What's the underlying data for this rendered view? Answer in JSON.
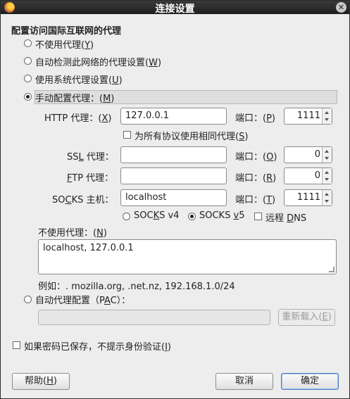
{
  "window": {
    "title": "连接设置"
  },
  "section_title": "配置访问国际互联网的代理",
  "options": {
    "no_proxy": {
      "label": "不使用代理(",
      "key": "Y",
      "tail": ")"
    },
    "auto_detect": {
      "label": "自动检测此网络的代理设置(",
      "key": "W",
      "tail": ")"
    },
    "system_proxy": {
      "label": "使用系统代理设置(",
      "key": "U",
      "tail": ")"
    },
    "manual": {
      "label": "手动配置代理：(",
      "key": "M",
      "tail": ")"
    }
  },
  "http": {
    "label_pre": "HTTP 代理：(",
    "key": "X",
    "label_post": ")",
    "value": "127.0.0.1",
    "port_label_pre": "端口：(",
    "port_key": "P",
    "port_label_post": ")",
    "port": "1111"
  },
  "same_proxy": {
    "label": "为所有协议使用相同代理(",
    "key": "S",
    "tail": ")"
  },
  "ssl": {
    "label_pre": "SS",
    "key": "L",
    "label_post": " 代理：",
    "value": "",
    "port_label_pre": "端口：(",
    "port_key": "O",
    "port_label_post": ")",
    "port": "0"
  },
  "ftp": {
    "label_pre": "",
    "key": "F",
    "label_post": "TP 代理：",
    "value": "",
    "port_label_pre": "端口：(",
    "port_key": "R",
    "port_label_post": ")",
    "port": "0"
  },
  "socks": {
    "label_pre": "SO",
    "key": "C",
    "label_post": "KS 主机：",
    "value": "localhost",
    "port_label_pre": "端口：(",
    "port_key": "T",
    "port_label_post": ")",
    "port": "1111"
  },
  "socks_v4": {
    "label_pre": "SOC",
    "key": "K",
    "label_post": "S v4"
  },
  "socks_v5": {
    "label_pre": "SOCKS ",
    "key": "v",
    "label_post": "5"
  },
  "remote_dns": {
    "label_pre": "远程 ",
    "key": "D",
    "label_post": "NS"
  },
  "no_proxy_for": {
    "label": "不使用代理：(",
    "key": "N",
    "tail": ")",
    "value": "localhost, 127.0.0.1"
  },
  "example": "例如：. mozilla.org, .net.nz, 192.168.1.0/24",
  "pac": {
    "label": "自动代理配置（P",
    "key": "A",
    "tail": "C）：",
    "value": "",
    "reload_pre": "重新载入(",
    "reload_key": "E",
    "reload_post": ")"
  },
  "no_auth": {
    "label": "如果密码已保存，不提示身份验证(",
    "key": "I",
    "tail": ")"
  },
  "buttons": {
    "help_pre": "帮助(",
    "help_key": "H",
    "help_post": ")",
    "cancel": "取消",
    "ok": "确定"
  }
}
